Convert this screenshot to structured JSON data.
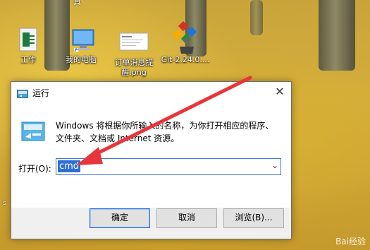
{
  "desktop": {
    "top_partial_label": "具",
    "icons": [
      {
        "label": "工作",
        "icon": "excel-file-icon"
      },
      {
        "label": "我的电脑",
        "icon": "computer-icon"
      },
      {
        "label": "订单消息提醒.png",
        "label_line1": "订单消息提",
        "label_line2": "醒.png",
        "icon": "image-file-icon"
      },
      {
        "label": "Git-2.24.0....",
        "icon": "git-installer-icon"
      }
    ],
    "left_edge_text": "s"
  },
  "run_dialog": {
    "title": "运行",
    "close_label": "✕",
    "description": "Windows 将根据你所输入的名称，为你打开相应的程序、文件夹、文档或 Internet 资源。",
    "open_label": "打开(O):",
    "input_value": "cmd",
    "buttons": {
      "ok": "确定",
      "cancel": "取消",
      "browse": "浏览(B)..."
    }
  },
  "watermark": "Bai经验",
  "colors": {
    "accent": "#2f6fd3",
    "arrow": "#e8353b"
  }
}
